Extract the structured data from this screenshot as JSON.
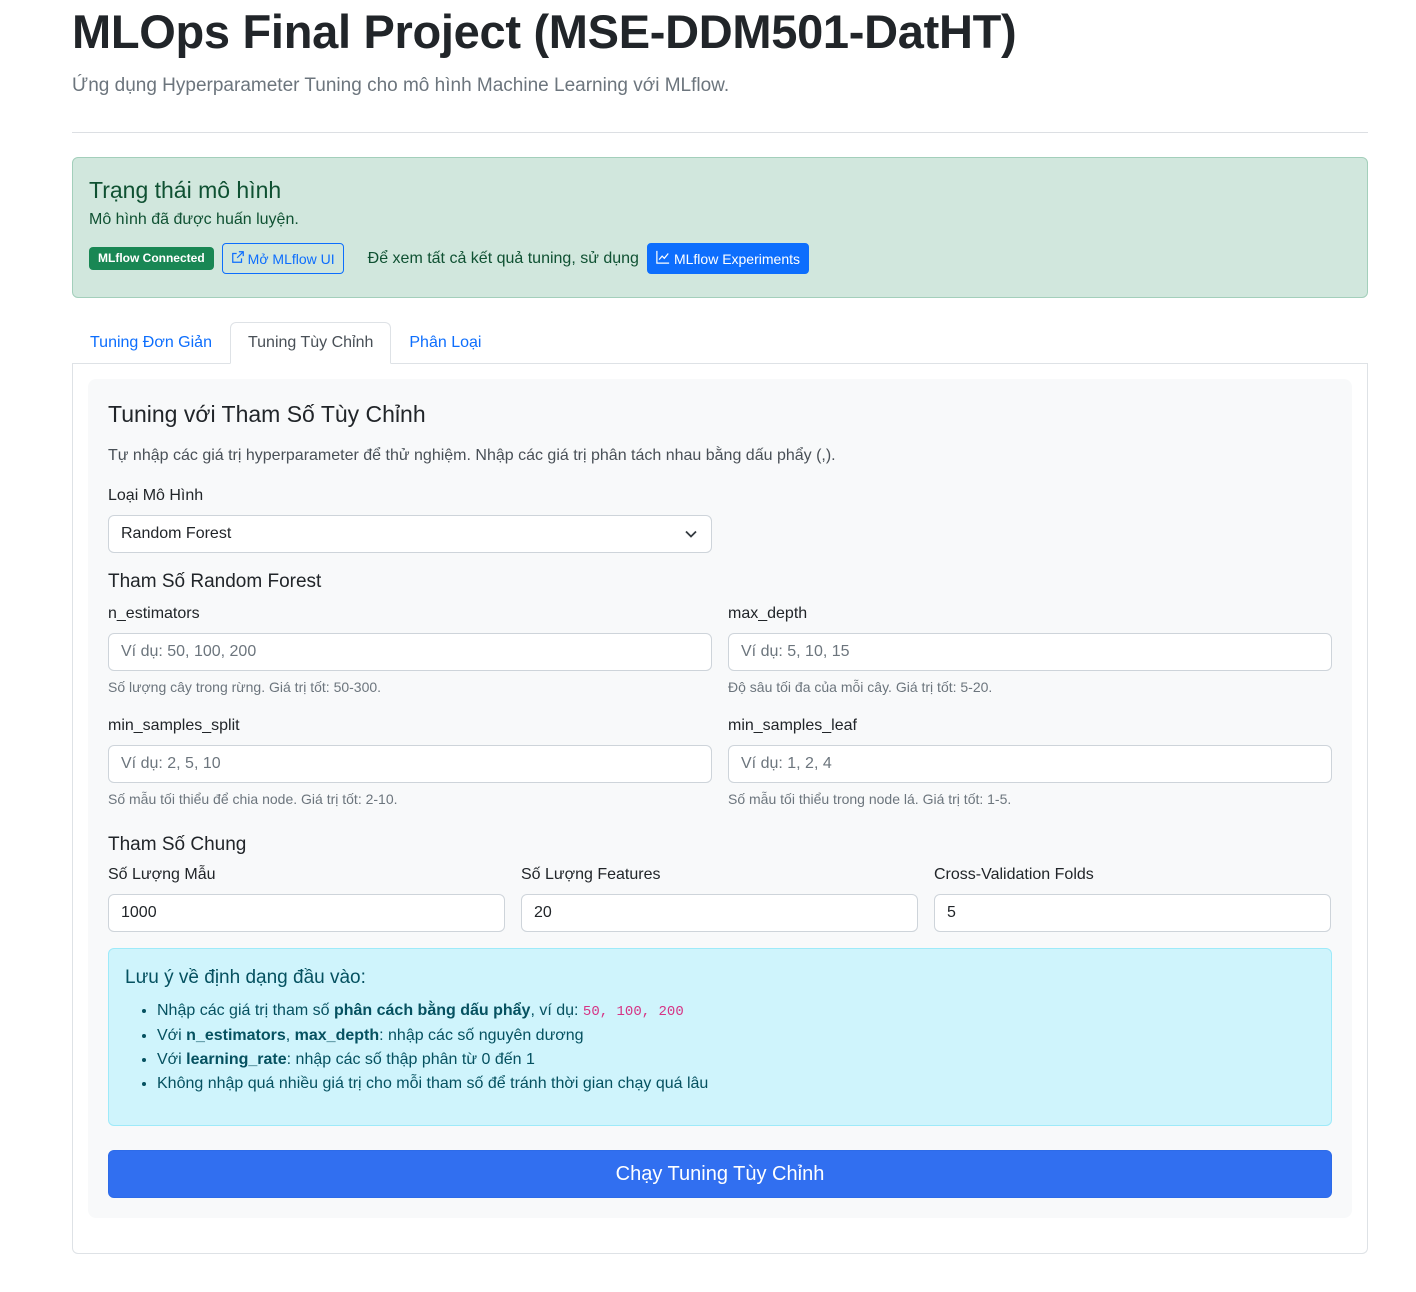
{
  "header": {
    "title": "MLOps Final Project (MSE-DDM501-DatHT)",
    "subtitle": "Ứng dụng Hyperparameter Tuning cho mô hình Machine Learning với MLflow."
  },
  "status": {
    "heading": "Trạng thái mô hình",
    "text": "Mô hình đã được huấn luyện.",
    "badge": "MLflow Connected",
    "open_ui_label": "Mở MLflow UI",
    "hint": "Để xem tất cả kết quả tuning, sử dụng",
    "experiments_label": "MLflow Experiments"
  },
  "tabs": [
    {
      "label": "Tuning Đơn Giản",
      "active": false
    },
    {
      "label": "Tuning Tùy Chỉnh",
      "active": true
    },
    {
      "label": "Phân Loại",
      "active": false
    }
  ],
  "panel": {
    "title": "Tuning với Tham Số Tùy Chỉnh",
    "description": "Tự nhập các giá trị hyperparameter để thử nghiệm. Nhập các giá trị phân tách nhau bằng dấu phẩy (,).",
    "model_type_label": "Loại Mô Hình",
    "model_type_value": "Random Forest",
    "rf_section_title": "Tham Số Random Forest",
    "params": [
      {
        "label": "n_estimators",
        "placeholder": "Ví dụ: 50, 100, 200",
        "help": "Số lượng cây trong rừng. Giá trị tốt: 50-300."
      },
      {
        "label": "max_depth",
        "placeholder": "Ví dụ: 5, 10, 15",
        "help": "Độ sâu tối đa của mỗi cây. Giá trị tốt: 5-20."
      },
      {
        "label": "min_samples_split",
        "placeholder": "Ví dụ: 2, 5, 10",
        "help": "Số mẫu tối thiểu để chia node. Giá trị tốt: 2-10."
      },
      {
        "label": "min_samples_leaf",
        "placeholder": "Ví dụ: 1, 2, 4",
        "help": "Số mẫu tối thiểu trong node lá. Giá trị tốt: 1-5."
      }
    ],
    "common_section_title": "Tham Số Chung",
    "common": [
      {
        "label": "Số Lượng Mẫu",
        "value": "1000"
      },
      {
        "label": "Số Lượng Features",
        "value": "20"
      },
      {
        "label": "Cross-Validation Folds",
        "value": "5"
      }
    ],
    "note": {
      "title": "Lưu ý về định dạng đầu vào:",
      "item1_pre": "Nhập các giá trị tham số ",
      "item1_bold": "phân cách bằng dấu phẩy",
      "item1_mid": ", ví dụ: ",
      "item1_code": "50, 100, 200",
      "item2_pre": "Với ",
      "item2_bold1": "n_estimators",
      "item2_sep": ", ",
      "item2_bold2": "max_depth",
      "item2_post": ": nhập các số nguyên dương",
      "item3_pre": "Với ",
      "item3_bold": "learning_rate",
      "item3_post": ": nhập các số thập phân từ 0 đến 1",
      "item4": "Không nhập quá nhiều giá trị cho mỗi tham số để tránh thời gian chạy quá lâu"
    },
    "run_button": "Chạy Tuning Tùy Chỉnh"
  },
  "colors": {
    "primary": "#0d6efd",
    "success_bg": "#d1e7dd",
    "info_bg": "#cff4fc",
    "run_button": "#316ff0"
  }
}
